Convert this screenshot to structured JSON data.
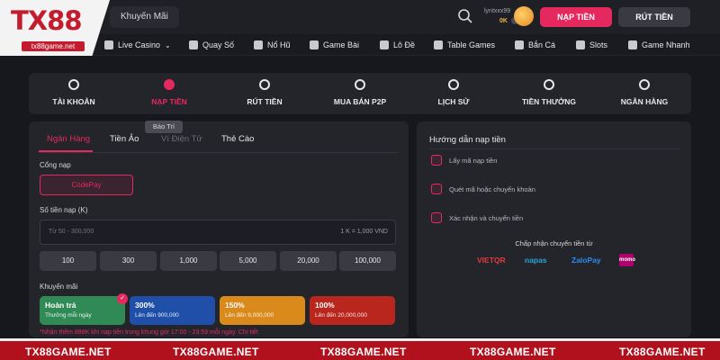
{
  "logo": {
    "text": "TX88",
    "url": "tx88game.net"
  },
  "header": {
    "promo_label": "Khuyến Mãi",
    "username": "lyntxxx99",
    "balance": "0K",
    "deposit_label": "NẠP TIỀN",
    "withdraw_label": "RÚT TIỀN"
  },
  "nav": {
    "items": [
      {
        "label": "Live Casino"
      },
      {
        "label": "Quay Số"
      },
      {
        "label": "Nổ Hũ"
      },
      {
        "label": "Game Bài"
      },
      {
        "label": "Lô Đề"
      },
      {
        "label": "Table Games"
      },
      {
        "label": "Bắn Cá"
      },
      {
        "label": "Slots"
      },
      {
        "label": "Game Nhanh"
      }
    ]
  },
  "account_tabs": [
    {
      "label": "TÀI KHOẢN",
      "icon": "user-icon"
    },
    {
      "label": "NẠP TIỀN",
      "icon": "plus-icon",
      "active": true
    },
    {
      "label": "RÚT TIỀN",
      "icon": "minus-icon"
    },
    {
      "label": "MUA BÁN P2P",
      "icon": "exchange-icon"
    },
    {
      "label": "LỊCH SỬ",
      "icon": "clock-icon"
    },
    {
      "label": "TIỀN THƯỞNG",
      "icon": "gift-icon"
    },
    {
      "label": "NGÂN HÀNG",
      "icon": "bank-icon"
    }
  ],
  "deposit": {
    "methods": [
      {
        "label": "Ngân Hàng",
        "active": true
      },
      {
        "label": "Tiền Ảo"
      },
      {
        "label": "Ví Điện Tử",
        "disabled": true
      },
      {
        "label": "Thẻ Cào"
      }
    ],
    "maintenance_tooltip": "Bảo Trì",
    "gateway_label": "Cổng nạp",
    "gateway_option": "CodePay",
    "amount_label": "Số tiền nạp (K)",
    "amount_placeholder": "Từ 50 - 300,000",
    "rate_text": "1 K = 1,000 VND",
    "quick_amounts": [
      "100",
      "300",
      "1,000",
      "5,000",
      "20,000",
      "100,000"
    ],
    "promo_label": "Khuyến mãi",
    "promos": [
      {
        "title": "Hoàn trả",
        "subtitle": "Thưởng mỗi ngày",
        "color": "#2f8a55",
        "selected": true
      },
      {
        "title": "300%",
        "subtitle": "Lên đến 900,000",
        "color": "#1f4fa8"
      },
      {
        "title": "150%",
        "subtitle": "Lên đến 9,000,000",
        "color": "#d98a1b"
      },
      {
        "title": "100%",
        "subtitle": "Lên đến 20,000,000",
        "color": "#b8261d"
      }
    ],
    "note": "*Nhận thêm 888K khi nạp tiền trong khung giờ 17:00 - 23:59 mỗi ngày. Chi tiết"
  },
  "guide": {
    "title": "Hướng dẫn nạp tiền",
    "steps": [
      "Lấy mã nạp tiền",
      "Quét mã hoặc chuyển khoản",
      "Xác nhận và chuyển tiền"
    ],
    "accept_title": "Chấp nhận chuyển tiền từ",
    "brands": [
      {
        "label": "VIETQR",
        "color": "#e23b3b"
      },
      {
        "label": "napas",
        "color": "#27a4d8"
      },
      {
        "label": "ZaloPay",
        "color": "#2d8cf0"
      },
      {
        "label": "momo",
        "color": "#b0006d"
      }
    ]
  },
  "footer": {
    "items": [
      "TX88GAME.NET",
      "TX88GAME.NET",
      "TX88GAME.NET",
      "TX88GAME.NET",
      "TX88GAME.NET"
    ]
  },
  "colors": {
    "accent": "#e5295f",
    "background": "#17181d",
    "panel": "#24252b",
    "footer": "#b1111d"
  }
}
